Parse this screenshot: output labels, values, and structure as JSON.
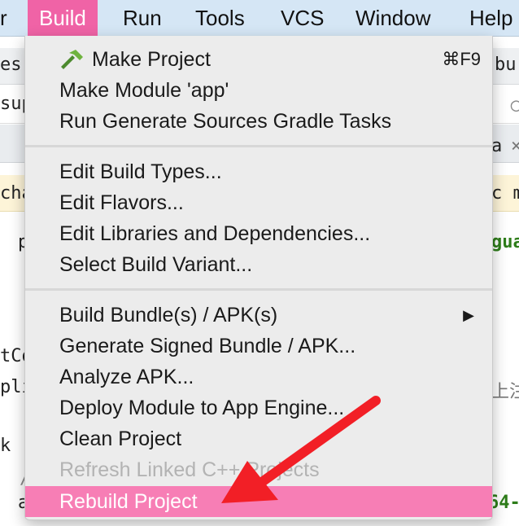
{
  "menubar": {
    "items": [
      "r",
      "Build",
      "Run",
      "Tools",
      "VCS",
      "Window",
      "Help"
    ],
    "active": "Build"
  },
  "background": {
    "fragments": [
      "es",
      "bu",
      "sup",
      "a",
      "cha",
      "c m",
      "p",
      "gua",
      "tCo",
      "pli",
      "上注",
      "k",
      "a",
      "64-",
      "/"
    ],
    "close_glyph": "×"
  },
  "menu": {
    "make_project": "Make Project",
    "make_project_shortcut": "⌘F9",
    "make_module": "Make Module 'app'",
    "run_generate": "Run Generate Sources Gradle Tasks",
    "edit_build_types": "Edit Build Types...",
    "edit_flavors": "Edit Flavors...",
    "edit_libraries": "Edit Libraries and Dependencies...",
    "select_variant": "Select Build Variant...",
    "build_bundle": "Build Bundle(s) / APK(s)",
    "submenu_glyph": "▶",
    "generate_signed": "Generate Signed Bundle / APK...",
    "analyze_apk": "Analyze APK...",
    "deploy_module": "Deploy Module to App Engine...",
    "clean_project": "Clean Project",
    "refresh_linked": "Refresh Linked C++ Projects",
    "rebuild_project": "Rebuild Project"
  },
  "colors": {
    "menubar_bg": "#d5e6f5",
    "active_menu": "#f063a6",
    "highlight": "#f77eb5",
    "arrow": "#f21f26",
    "green_text": "#2e7d1a"
  }
}
